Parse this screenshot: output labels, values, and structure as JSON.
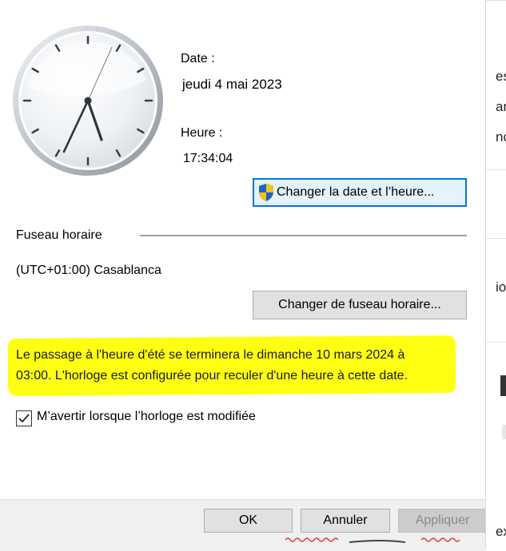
{
  "date": {
    "label": "Date :",
    "value": "jeudi 4 mai 2023"
  },
  "time": {
    "label": "Heure :",
    "value": "17:34:04"
  },
  "buttons": {
    "change_datetime": "Changer la date et l’heure...",
    "change_timezone": "Changer de fuseau horaire...",
    "ok": "OK",
    "cancel": "Annuler",
    "apply": "Appliquer"
  },
  "timezone": {
    "section_label": "Fuseau horaire",
    "value": "(UTC+01:00) Casablanca"
  },
  "dst_notice": {
    "line1": "Le passage à l'heure d'été se terminera le dimanche 10 mars 2024 à",
    "line2": "03:00. L'horloge est configurée pour reculer d'une heure à cette date."
  },
  "notify": {
    "label": "M’avertir lorsque l’horloge est modifiée",
    "checked": true
  },
  "background_fragments": [
    "es",
    "ar",
    "nc",
    "io",
    "ex"
  ],
  "colors": {
    "highlight": "#ffff14",
    "focus_border": "#0078d7",
    "footer": "#f0f0f0"
  }
}
